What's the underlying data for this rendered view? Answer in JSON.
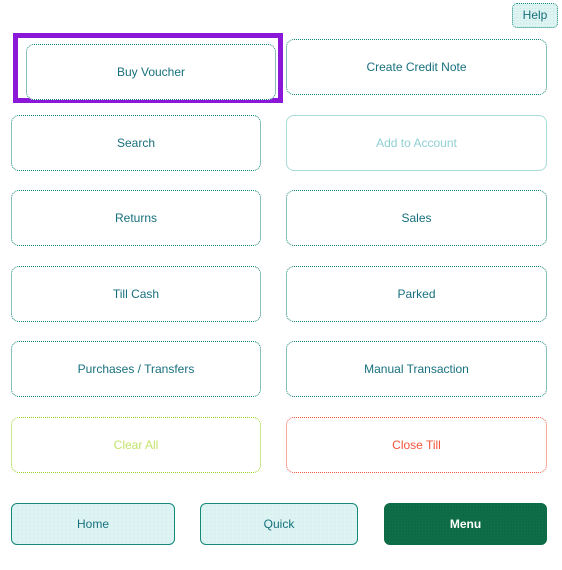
{
  "header": {
    "help_label": "Help"
  },
  "colors": {
    "accent_teal": "#17707d",
    "border_teal": "#0e8271",
    "focus_purple": "#8b18d8",
    "warn_green": "#93d01b",
    "danger_red": "#f4543c",
    "menu_green": "#0d6b45",
    "tint_bg": "#ddf4f2",
    "disabled_text": "#8fcfd4"
  },
  "grid": {
    "rows": [
      {
        "left": {
          "label": "Buy Voucher",
          "state": "focused"
        },
        "right": {
          "label": "Create Credit Note",
          "state": "normal"
        }
      },
      {
        "left": {
          "label": "Search",
          "state": "normal"
        },
        "right": {
          "label": "Add to Account",
          "state": "disabled"
        }
      },
      {
        "left": {
          "label": "Returns",
          "state": "normal"
        },
        "right": {
          "label": "Sales",
          "state": "normal"
        }
      },
      {
        "left": {
          "label": "Till Cash",
          "state": "normal"
        },
        "right": {
          "label": "Parked",
          "state": "normal"
        }
      },
      {
        "left": {
          "label": "Purchases / Transfers",
          "state": "normal"
        },
        "right": {
          "label": "Manual Transaction",
          "state": "normal"
        }
      },
      {
        "left": {
          "label": "Clear All",
          "state": "warn"
        },
        "right": {
          "label": "Close Till",
          "state": "danger"
        }
      }
    ]
  },
  "bottom_nav": {
    "home_label": "Home",
    "quick_label": "Quick",
    "menu_label": "Menu"
  }
}
